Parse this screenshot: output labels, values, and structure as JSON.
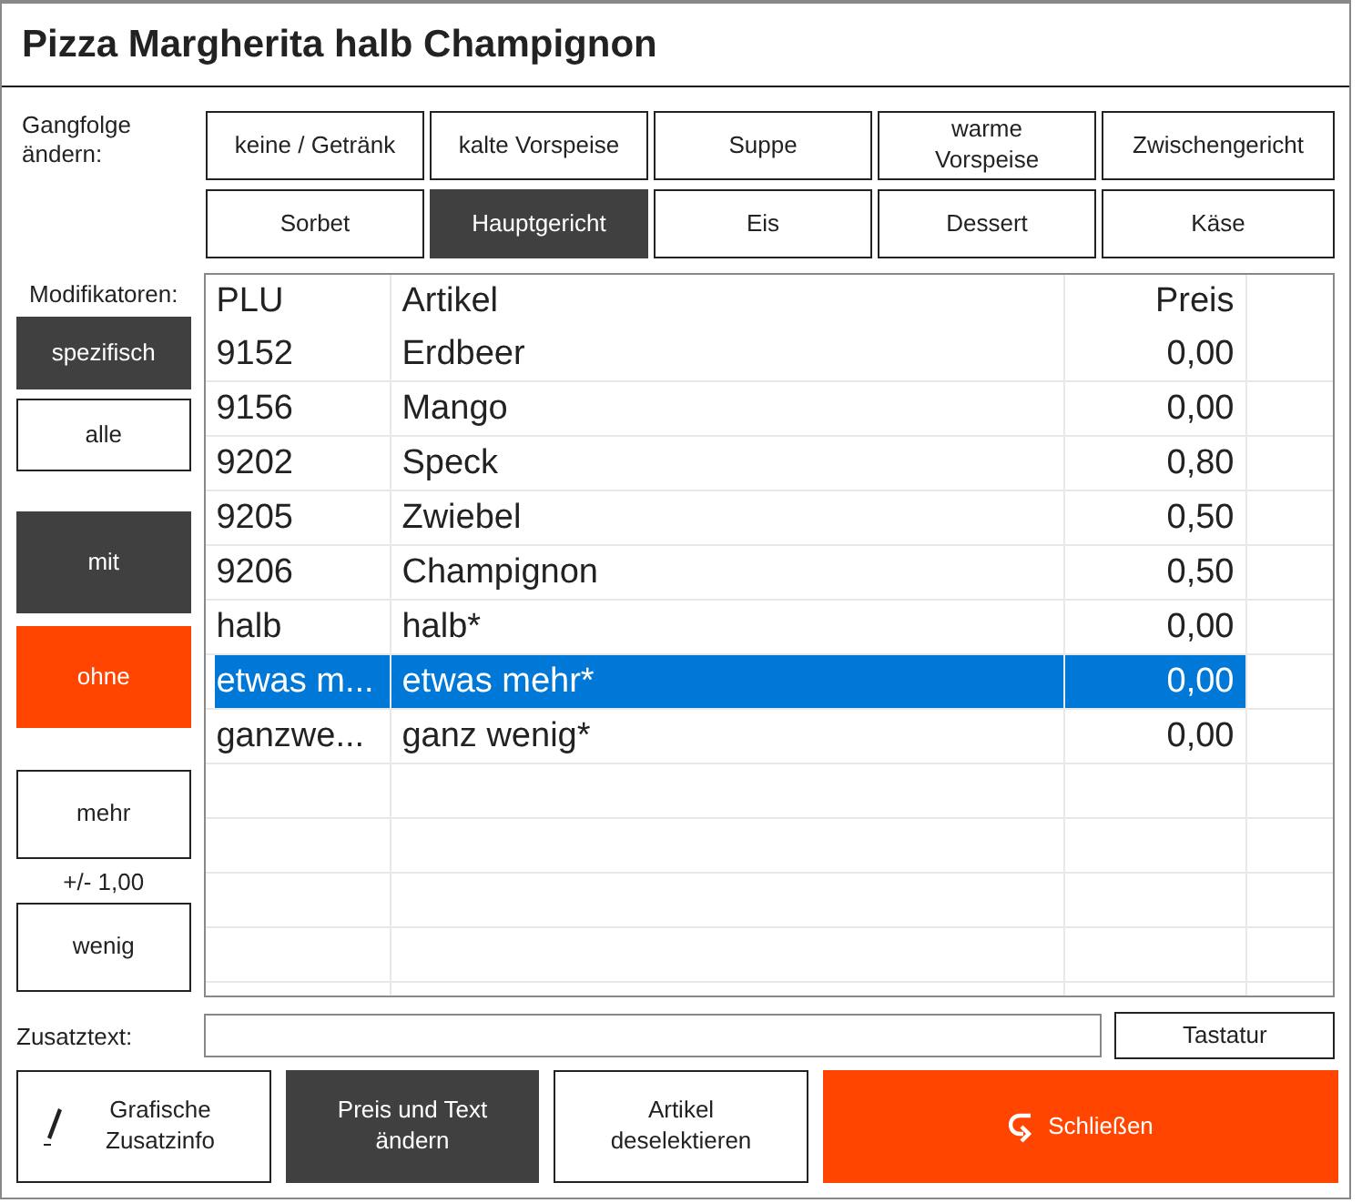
{
  "window": {
    "title": "Pizza Margherita halb Champignon"
  },
  "course": {
    "label": "Gangfolge ändern:",
    "buttons": [
      {
        "label": "keine / Getränk",
        "selected": false
      },
      {
        "label": "kalte Vorspeise",
        "selected": false
      },
      {
        "label": "Suppe",
        "selected": false
      },
      {
        "label": "warme Vorspeise",
        "selected": false
      },
      {
        "label": "Zwischengericht",
        "selected": false
      },
      {
        "label": "Sorbet",
        "selected": false
      },
      {
        "label": "Hauptgericht",
        "selected": true
      },
      {
        "label": "Eis",
        "selected": false
      },
      {
        "label": "Dessert",
        "selected": false
      },
      {
        "label": "Käse",
        "selected": false
      }
    ]
  },
  "modifiers": {
    "label": "Modifikatoren:",
    "buttons": [
      {
        "label": "spezifisch",
        "kind": "dark"
      },
      {
        "label": "alle",
        "kind": "plain"
      },
      {
        "label": "mit",
        "kind": "dark"
      },
      {
        "label": "ohne",
        "kind": "accent"
      },
      {
        "label": "mehr",
        "kind": "plain"
      },
      {
        "label": "wenig",
        "kind": "plain"
      }
    ],
    "step": "+/- 1,00"
  },
  "table": {
    "columns": [
      "PLU",
      "Artikel",
      "Preis"
    ],
    "rows": [
      {
        "plu": "9152",
        "artikel": "Erdbeer",
        "preis": "0,00",
        "selected": false
      },
      {
        "plu": "9156",
        "artikel": "Mango",
        "preis": "0,00",
        "selected": false
      },
      {
        "plu": "9202",
        "artikel": "Speck",
        "preis": "0,80",
        "selected": false
      },
      {
        "plu": "9205",
        "artikel": "Zwiebel",
        "preis": "0,50",
        "selected": false
      },
      {
        "plu": "9206",
        "artikel": "Champignon",
        "preis": "0,50",
        "selected": false
      },
      {
        "plu": "halb",
        "artikel": "halb*",
        "preis": "0,00",
        "selected": false
      },
      {
        "plu": "etwas m...",
        "artikel": "etwas mehr*",
        "preis": "0,00",
        "selected": true
      },
      {
        "plu": "ganzwe...",
        "artikel": "ganz wenig*",
        "preis": "0,00",
        "selected": false
      }
    ]
  },
  "extra_text": {
    "label": "Zusatztext:",
    "keyboard_button": "Tastatur"
  },
  "actions": [
    {
      "label": "Grafische Zusatzinfo",
      "kind": "pen"
    },
    {
      "label": "Preis und Text ändern",
      "kind": "dark"
    },
    {
      "label": "Artikel deselektieren",
      "kind": "plain"
    },
    {
      "label": "Schließen",
      "kind": "close"
    }
  ]
}
